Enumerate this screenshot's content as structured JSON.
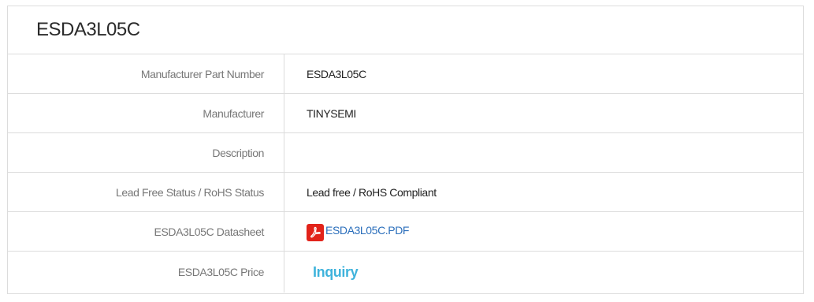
{
  "panel": {
    "title": "ESDA3L05C"
  },
  "rows": [
    {
      "label": "Manufacturer Part Number",
      "value": "ESDA3L05C"
    },
    {
      "label": "Manufacturer",
      "value": "TINYSEMI"
    },
    {
      "label": "Description",
      "value": ""
    },
    {
      "label": "Lead Free Status / RoHS Status",
      "value": "Lead free / RoHS Compliant"
    },
    {
      "label": "ESDA3L05C Datasheet",
      "link_text": "ESDA3L05C.PDF",
      "icon": "pdf-icon"
    },
    {
      "label": "ESDA3L05C Price",
      "link_text": "Inquiry"
    }
  ],
  "colors": {
    "border": "#dcdcdc",
    "label_text": "#777777",
    "link_blue": "#2a6ebb",
    "inquiry_cyan": "#3fb3dc",
    "pdf_red": "#e2231a"
  }
}
